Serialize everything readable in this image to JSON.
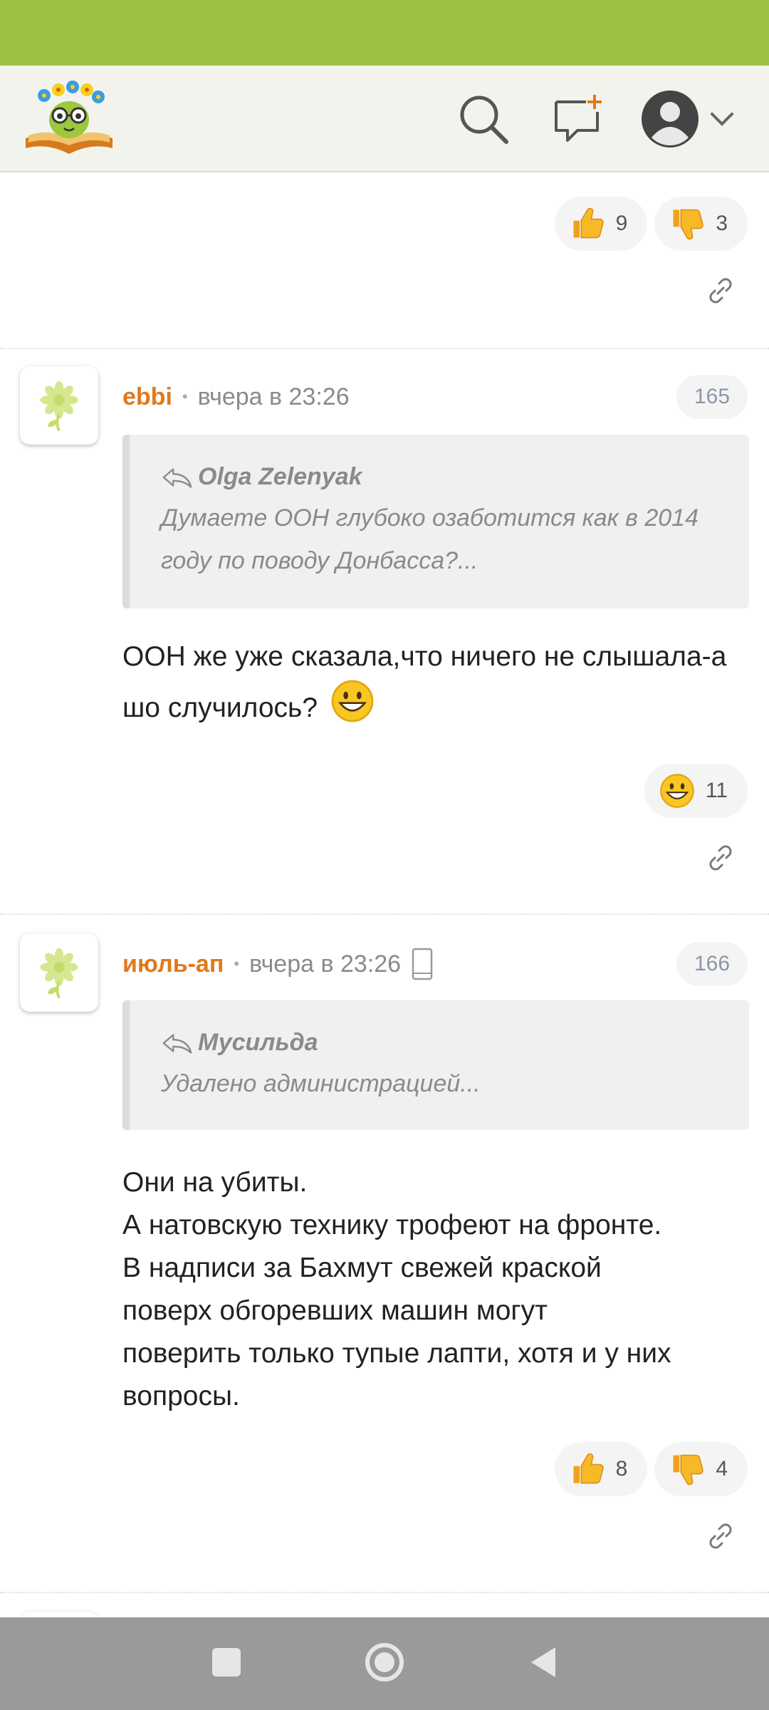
{
  "colors": {
    "statusbar": "#9dc143",
    "accent": "#e07a1a",
    "navbar": "#9a9a9a"
  },
  "header": {
    "logo": "smartbook-logo",
    "icons": [
      "search-icon",
      "new-message-icon",
      "avatar-icon",
      "chevron-down-icon"
    ]
  },
  "top_reactions": {
    "likes": "9",
    "dislikes": "3"
  },
  "comments": [
    {
      "author": "ebbi",
      "time": "вчера в 23:26",
      "number": "165",
      "quote_author": "Olga Zelenyak",
      "quote_text": "Думаете ООН глубоко озаботится как в 2014 году по поводу Донбасса?...",
      "text": "ООН же уже сказала,что ничего не слышала-а шо случилось?",
      "reaction_count": "11"
    },
    {
      "author": "июль-ап",
      "time": "вчера в 23:26",
      "number": "166",
      "quote_author": "Мусильда",
      "quote_text": "Удалено администрацией...",
      "text_lines": [
        "Они на убиты.",
        "А натовскую технику трофеют на фронте.",
        "В надписи за Бахмут свежей краской",
        "поверх обгоревших машин могут",
        "поверить только тупые лапти, хотя и у них",
        "вопросы."
      ],
      "likes": "8",
      "dislikes": "4"
    }
  ]
}
